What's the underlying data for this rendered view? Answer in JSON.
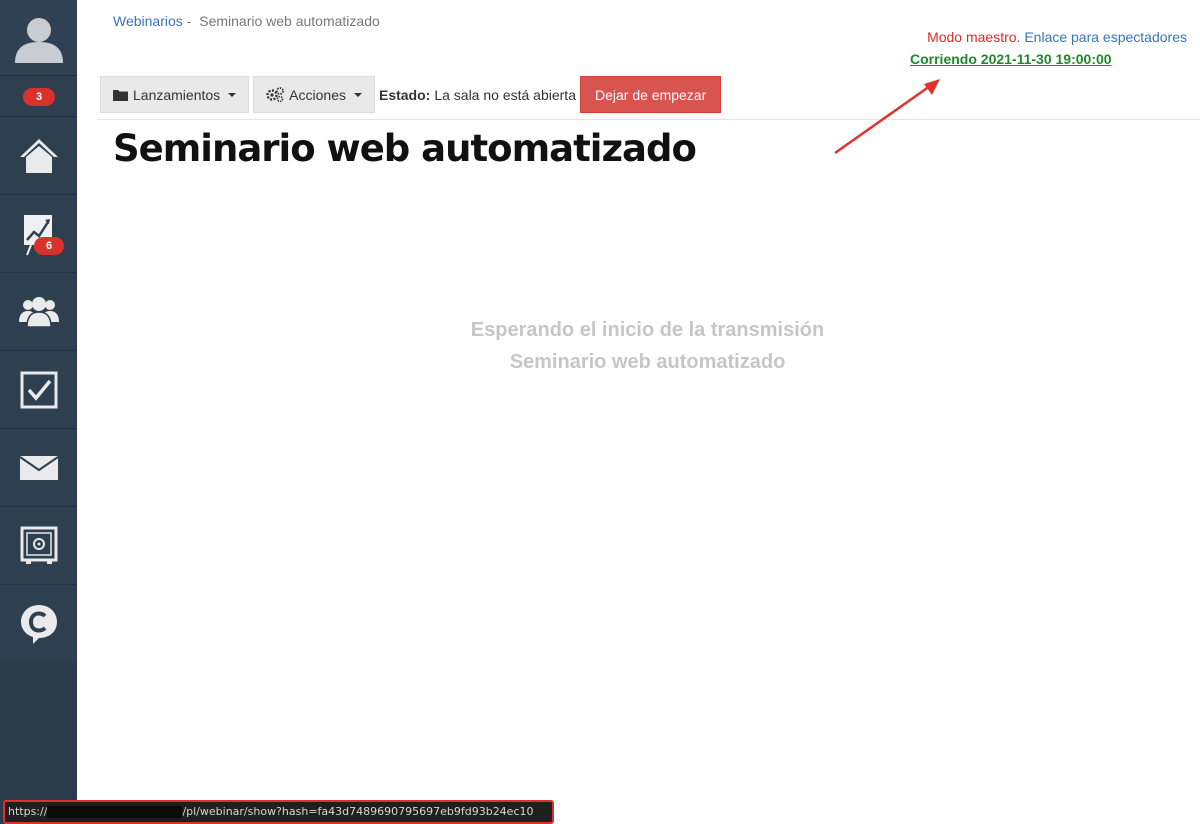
{
  "sidebar": {
    "notifications_count": "3",
    "items": [
      {
        "name": "home",
        "icon": "home-icon"
      },
      {
        "name": "webinars",
        "icon": "presentation-chart-icon",
        "badge": "6"
      },
      {
        "name": "users",
        "icon": "users-icon"
      },
      {
        "name": "tasks",
        "icon": "checkbox-icon"
      },
      {
        "name": "mail",
        "icon": "envelope-icon"
      },
      {
        "name": "safe",
        "icon": "safe-icon"
      },
      {
        "name": "chat",
        "icon": "chat-c-icon"
      }
    ]
  },
  "breadcrumb": {
    "root": "Webinarios",
    "separator": "-",
    "current": "Seminario web automatizado"
  },
  "header_right": {
    "master_mode": "Modo maestro.",
    "viewers_link": "Enlace para espectadores",
    "running": "Corriendo 2021-11-30 19:00:00"
  },
  "toolbar": {
    "launches": "Lanzamientos",
    "actions": "Acciones",
    "status_label": "Estado:",
    "status_value": "La sala no está abierta",
    "stop_button": "Dejar de empezar"
  },
  "page_title": "Seminario web automatizado",
  "waiting": {
    "line1": "Esperando el inicio de la transmisión",
    "line2": "Seminario web automatizado"
  },
  "statusbar": {
    "prefix": "https://",
    "path": "/pl/webinar/show?hash=fa43d7489690795697eb9fd93b24ec10"
  },
  "colors": {
    "sidebar": "#2e3f4f",
    "link": "#3b73b9",
    "danger": "#d9534f",
    "running": "#1f8a2a",
    "arrow": "#e0342b"
  }
}
